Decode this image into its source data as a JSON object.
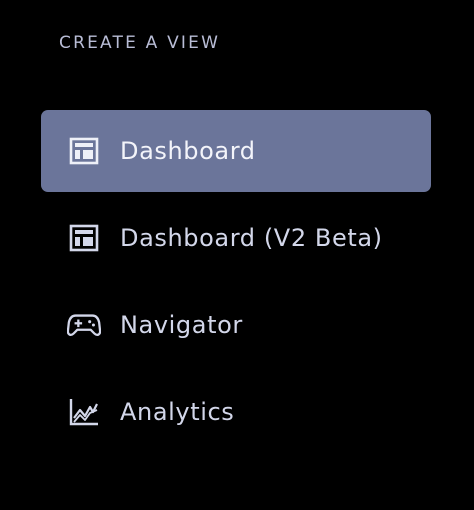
{
  "panel": {
    "section_title": "CREATE A VIEW"
  },
  "menu": {
    "items": [
      {
        "label": "Dashboard",
        "icon": "dashboard-icon",
        "selected": true
      },
      {
        "label": "Dashboard (V2 Beta)",
        "icon": "dashboard-icon",
        "selected": false
      },
      {
        "label": "Navigator",
        "icon": "gamepad-icon",
        "selected": false
      },
      {
        "label": "Analytics",
        "icon": "line-chart-icon",
        "selected": false
      }
    ]
  },
  "colors": {
    "background": "#000000",
    "selected_bg": "#6b759a",
    "text": "#d3d7ea",
    "title_text": "#b9bdd6"
  }
}
